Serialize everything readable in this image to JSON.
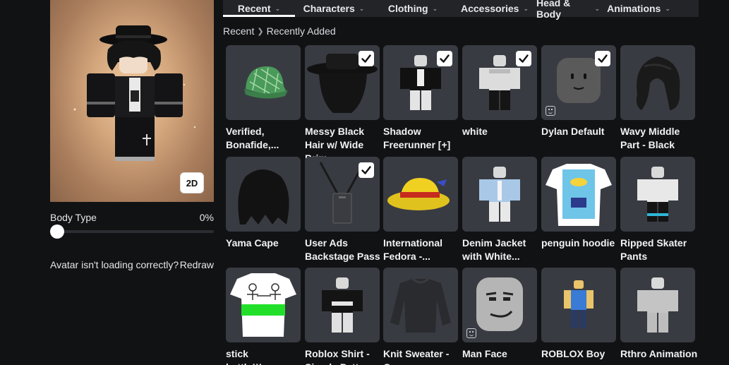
{
  "tabs": [
    {
      "label": "Recent",
      "active": true
    },
    {
      "label": "Characters"
    },
    {
      "label": "Clothing"
    },
    {
      "label": "Accessories"
    },
    {
      "label": "Head & Body"
    },
    {
      "label": "Animations"
    }
  ],
  "breadcrumb": {
    "root": "Recent",
    "current": "Recently Added"
  },
  "avatar": {
    "view_toggle": "2D"
  },
  "body_type": {
    "label": "Body Type",
    "value_text": "0%",
    "value": 0
  },
  "loading": {
    "message": "Avatar isn't loading correctly?",
    "action": "Redraw"
  },
  "items": [
    {
      "name": "Verified, Bonafide,...",
      "checked": false,
      "icon": "green-plaid-cap-icon"
    },
    {
      "name": "Messy Black Hair w/ Wide Brim...",
      "checked": true,
      "icon": "black-hat-hair-icon"
    },
    {
      "name": "Shadow Freerunner [+]",
      "checked": true,
      "icon": "shadow-outfit-icon"
    },
    {
      "name": "white",
      "checked": true,
      "icon": "white-outfit-icon"
    },
    {
      "name": "Dylan Default",
      "checked": true,
      "emote": true,
      "icon": "face-icon"
    },
    {
      "name": "Wavy Middle Part - Black",
      "checked": false,
      "icon": "black-wavy-hair-icon"
    },
    {
      "name": "Yama Cape",
      "checked": false,
      "icon": "black-long-hair-icon"
    },
    {
      "name": "User Ads Backstage Pass",
      "checked": true,
      "icon": "lanyard-pass-icon"
    },
    {
      "name": "International Fedora -...",
      "checked": false,
      "icon": "yellow-fedora-icon"
    },
    {
      "name": "Denim Jacket with White...",
      "checked": false,
      "icon": "denim-jacket-icon"
    },
    {
      "name": "penguin hoodie",
      "checked": false,
      "icon": "penguin-shirt-icon"
    },
    {
      "name": "Ripped Skater Pants",
      "checked": false,
      "icon": "skater-pants-icon"
    },
    {
      "name": "stick battle!!!.png",
      "checked": false,
      "icon": "stick-battle-shirt-icon"
    },
    {
      "name": "Roblox Shirt - Simple Pattern",
      "checked": false,
      "icon": "simple-shirt-icon"
    },
    {
      "name": "Knit Sweater - Gray",
      "checked": false,
      "icon": "gray-sweater-icon"
    },
    {
      "name": "Man Face",
      "checked": false,
      "emote": true,
      "icon": "man-face-icon"
    },
    {
      "name": "ROBLOX Boy",
      "checked": false,
      "icon": "roblox-boy-icon"
    },
    {
      "name": "Rthro Animation",
      "checked": false,
      "icon": "rthro-animation-icon"
    }
  ]
}
